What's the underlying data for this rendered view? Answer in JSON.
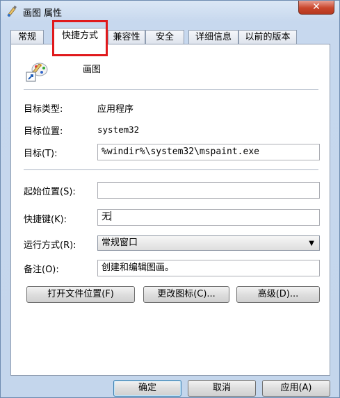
{
  "window": {
    "title": "画图 属性",
    "close_glyph": "✕"
  },
  "tabs": [
    {
      "label": "常规",
      "active": false
    },
    {
      "label": "快捷方式",
      "active": true
    },
    {
      "label": "兼容性",
      "active": false
    },
    {
      "label": "安全",
      "active": false
    },
    {
      "label": "详细信息",
      "active": false
    },
    {
      "label": "以前的版本",
      "active": false
    }
  ],
  "shortcut": {
    "name": "画图",
    "target_type_label": "目标类型:",
    "target_type_value": "应用程序",
    "target_location_label": "目标位置:",
    "target_location_value": "system32",
    "target_label": "目标(T):",
    "target_value": "%windir%\\system32\\mspaint.exe",
    "start_in_label": "起始位置(S):",
    "start_in_value": "",
    "hotkey_label": "快捷键(K):",
    "hotkey_value": "无",
    "run_label": "运行方式(R):",
    "run_value": "常规窗口",
    "comment_label": "备注(O):",
    "comment_value": "创建和编辑图画。"
  },
  "buttons": {
    "open_location": "打开文件位置(F)",
    "change_icon": "更改图标(C)...",
    "advanced": "高级(D)...",
    "ok": "确定",
    "cancel": "取消",
    "apply": "应用(A)"
  },
  "colors": {
    "highlight": "#e0191c",
    "titlebar": "#c7d8ee",
    "close": "#c9462c"
  }
}
